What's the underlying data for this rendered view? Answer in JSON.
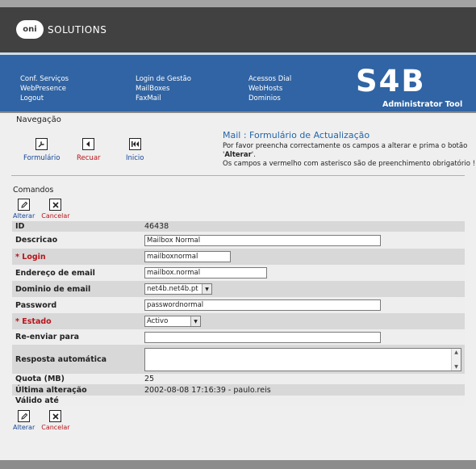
{
  "header": {
    "logo_mark": "oni",
    "logo_text": "SOLUTIONS"
  },
  "nav": {
    "col1": [
      "Conf. Serviços",
      "WebPresence",
      "Logout"
    ],
    "col2": [
      "Login de Gestão",
      "MailBoxes",
      "FaxMail"
    ],
    "col3": [
      "Acessos Dial",
      "WebHosts",
      "Dominios"
    ]
  },
  "brand": {
    "name": "S4B",
    "subtitle": "Administrator Tool"
  },
  "navegacao": {
    "title": "Navegação",
    "buttons": [
      {
        "label": "Formulário",
        "icon": "wrench-icon"
      },
      {
        "label": "Recuar",
        "icon": "back-icon"
      },
      {
        "label": "Inicio",
        "icon": "first-icon"
      }
    ]
  },
  "info": {
    "title": "Mail : Formulário de Actualização",
    "line1_pre": "Por favor preencha correctamente os campos a alterar e prima o botão '",
    "line1_bold": "Alterar",
    "line1_post": "'.",
    "line2": "Os campos a vermelho com asterisco são de preenchimento obrigatório !"
  },
  "comandos": {
    "title": "Comandos",
    "alterar": "Alterar",
    "cancelar": "Cancelar"
  },
  "form": {
    "id": {
      "label": "ID",
      "value": "46438"
    },
    "descricao": {
      "label": "Descricao",
      "value": "Mailbox Normal"
    },
    "login": {
      "label": "* Login",
      "value": "mailboxnormal"
    },
    "email": {
      "label": "Endereço de email",
      "value": "mailbox.normal"
    },
    "dominio": {
      "label": "Dominio de email",
      "value": "net4b.net4b.pt"
    },
    "password": {
      "label": "Password",
      "value": "passwordnormal"
    },
    "estado": {
      "label": "* Estado",
      "value": "Activo"
    },
    "reenviar": {
      "label": "Re-enviar para",
      "value": ""
    },
    "resposta": {
      "label": "Resposta automática",
      "value": ""
    },
    "quota": {
      "label": "Quota (MB)",
      "value": "25"
    },
    "ultima": {
      "label": "Última alteração",
      "value": "2002-08-08 17:16:39 - paulo.reis"
    },
    "valido": {
      "label": "Válido até",
      "value": ""
    }
  },
  "colors": {
    "nav_blue": "#3064a4",
    "required_red": "#b8141b",
    "link_blue": "#16469a"
  }
}
